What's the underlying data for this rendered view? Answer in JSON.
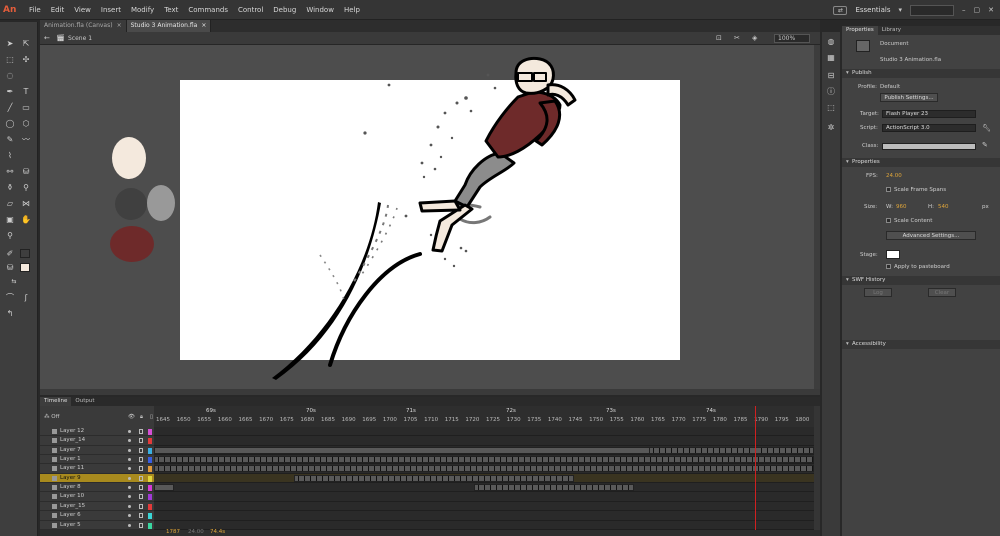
{
  "app": {
    "logo": "An",
    "menu": [
      "File",
      "Edit",
      "View",
      "Insert",
      "Modify",
      "Text",
      "Commands",
      "Control",
      "Debug",
      "Window",
      "Help"
    ],
    "workspace": "Essentials"
  },
  "tabs": [
    {
      "label": "Animation.fla (Canvas)",
      "close": "×"
    },
    {
      "label": "Studio 3 Animation.fla",
      "close": "×"
    }
  ],
  "editbar": {
    "scene": "Scene 1",
    "zoom": "100%"
  },
  "properties": {
    "tabs": [
      "Properties",
      "Library"
    ],
    "doc_label": "Document",
    "doc_name": "Studio 3 Animation.fla",
    "publish": {
      "header": "Publish",
      "profile_label": "Profile:",
      "profile": "Default",
      "settings_btn": "Publish Settings...",
      "target_label": "Target:",
      "target": "Flash Player 23",
      "script_label": "Script:",
      "script": "ActionScript 3.0",
      "class_label": "Class:"
    },
    "props": {
      "header": "Properties",
      "fps_label": "FPS:",
      "fps": "24.00",
      "scale_spans": "Scale Frame Spans",
      "size_label": "Size:",
      "w_label": "W:",
      "w": "960",
      "h_label": "H:",
      "h": "540",
      "px": "px",
      "scale_content": "Scale Content",
      "advanced_btn": "Advanced Settings...",
      "stage_label": "Stage:",
      "apply_paste": "Apply to pasteboard",
      "stage_color": "#ffffff"
    },
    "swf": {
      "header": "SWF History",
      "log_btn": "Log",
      "clear_btn": "Clear"
    },
    "access": {
      "header": "Accessibility"
    }
  },
  "timeline": {
    "tabs": [
      "Timeline",
      "Output"
    ],
    "off_label": "Off",
    "seconds": [
      "69s",
      "70s",
      "71s",
      "72s",
      "73s",
      "74s"
    ],
    "frames": [
      "1645",
      "1650",
      "1655",
      "1660",
      "1665",
      "1670",
      "1675",
      "1680",
      "1685",
      "1690",
      "1695",
      "1700",
      "1705",
      "1710",
      "1715",
      "1720",
      "1725",
      "1730",
      "1735",
      "1740",
      "1745",
      "1750",
      "1755",
      "1760",
      "1765",
      "1770",
      "1775",
      "1780",
      "1785",
      "1790",
      "1795",
      "1800"
    ],
    "layers": [
      {
        "name": "Layer 12",
        "color": "#d64fd6"
      },
      {
        "name": "Layer_14",
        "color": "#e23a3a"
      },
      {
        "name": "Layer 7",
        "color": "#3ab0e2"
      },
      {
        "name": "Layer 1",
        "color": "#3a5ee2"
      },
      {
        "name": "Layer 11",
        "color": "#e29a3a"
      },
      {
        "name": "Layer 9",
        "color": "#e2d63a",
        "selected": true
      },
      {
        "name": "Layer 8",
        "color": "#d63ad6"
      },
      {
        "name": "Layer 10",
        "color": "#a03ad6"
      },
      {
        "name": "Layer_15",
        "color": "#e23a3a"
      },
      {
        "name": "Layer 6",
        "color": "#3ad6d6"
      },
      {
        "name": "Layer 5",
        "color": "#3ad6a0"
      }
    ],
    "current_frame": "1787",
    "fps": "24.00",
    "time": "74.4s"
  },
  "swatches": {
    "skin": "#f4e9dd",
    "dark": "#404040",
    "grey": "#999999",
    "maroon": "#6e2a2a"
  }
}
